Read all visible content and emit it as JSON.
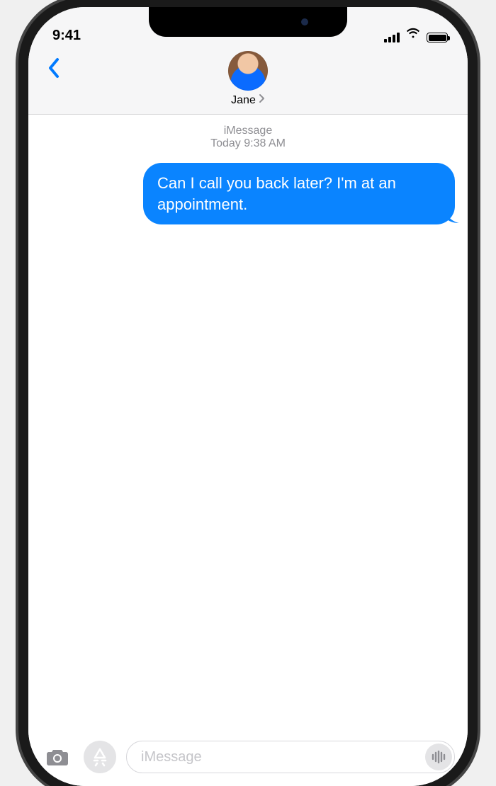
{
  "status": {
    "time": "9:41"
  },
  "header": {
    "contact_name": "Jane"
  },
  "thread": {
    "service_label": "iMessage",
    "timestamp": "Today 9:38 AM",
    "messages": [
      {
        "text": "Can I call you back later? I'm at an appointment."
      }
    ]
  },
  "compose": {
    "placeholder": "iMessage"
  },
  "colors": {
    "accent": "#007aff",
    "bubble": "#0a84ff"
  }
}
